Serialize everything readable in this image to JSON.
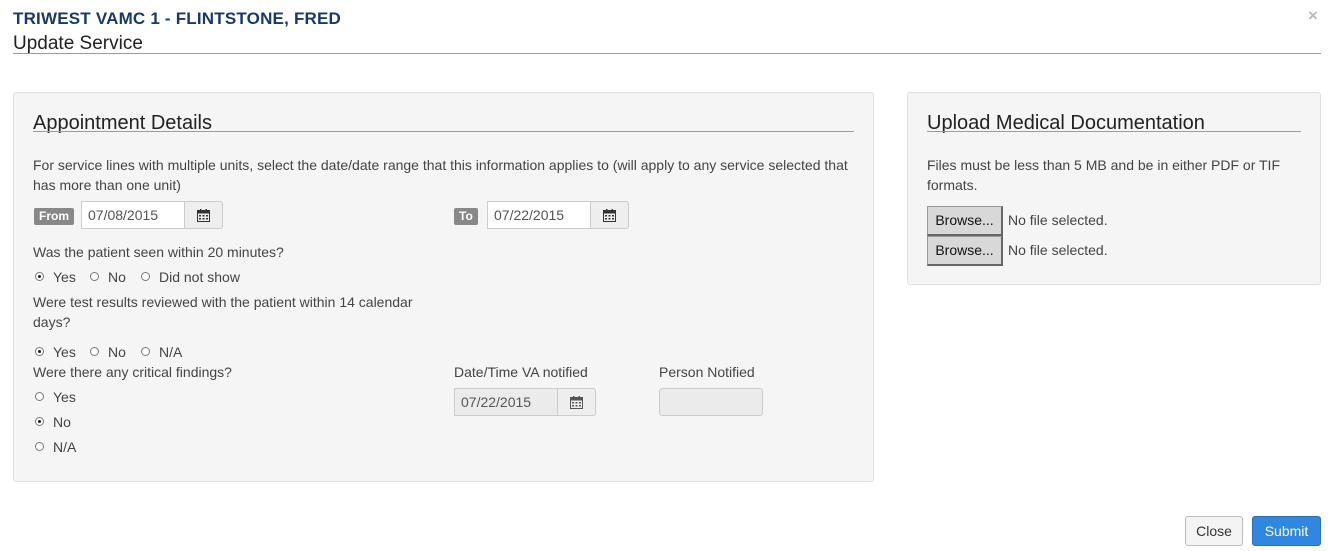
{
  "header": {
    "patient_title": "TRIWEST VAMC 1 - FLINTSTONE, FRED",
    "modal_title": "Update Service",
    "close_glyph": "×"
  },
  "appointment": {
    "heading": "Appointment Details",
    "instructions": "For service lines with multiple units, select the date/date range that this information applies to (will apply to any service selected that has more than one unit)",
    "from_label": "From",
    "from_date": "07/08/2015",
    "to_label": "To",
    "to_date": "07/22/2015",
    "q_seen_20": {
      "question": "Was the patient seen within 20 minutes?",
      "options": [
        "Yes",
        "No",
        "Did not show"
      ],
      "selected": "Yes"
    },
    "q_test_results": {
      "question": "Were test results reviewed with the patient within 14 calendar days?",
      "options": [
        "Yes",
        "No",
        "N/A"
      ],
      "selected": "Yes"
    },
    "q_critical": {
      "question": "Were there any critical findings?",
      "options": [
        "Yes",
        "No",
        "N/A"
      ],
      "selected": "No"
    },
    "va_notified_label": "Date/Time VA notified",
    "va_notified_date": "07/22/2015",
    "person_notified_label": "Person Notified",
    "person_notified_value": ""
  },
  "upload": {
    "heading": "Upload Medical Documentation",
    "note": "Files must be less than 5 MB and be in either PDF or TIF formats.",
    "files": [
      {
        "button": "Browse...",
        "status": "No file selected."
      },
      {
        "button": "Browse...",
        "status": "No file selected."
      }
    ]
  },
  "footer": {
    "close_label": "Close",
    "submit_label": "Submit"
  },
  "icons": {
    "calendar": "calendar-icon",
    "close": "close-icon"
  },
  "colors": {
    "title_blue": "#1b3a6b",
    "rule_gold": "#b8a040",
    "primary": "#2f87e0"
  }
}
